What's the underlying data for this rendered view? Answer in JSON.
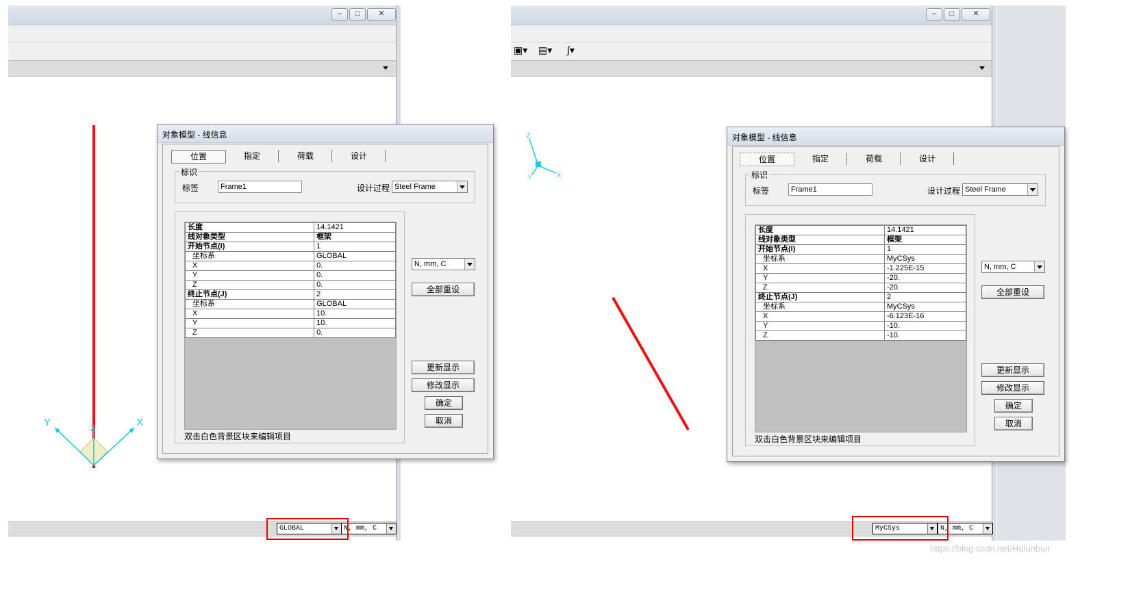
{
  "left": {
    "dialog": {
      "title": "对象模型 - 线信息",
      "tabs": [
        "位置",
        "指定",
        "荷载",
        "设计"
      ],
      "group_label": "标识",
      "label_caption": "标签",
      "label_value": "Frame1",
      "design_proc_caption": "设计过程",
      "design_proc_value": "Steel Frame",
      "rows": [
        {
          "k": "长度",
          "v": "14.1421",
          "bold": true
        },
        {
          "k": "线对象类型",
          "v": "框架",
          "bold": true
        },
        {
          "k": "开始节点(I)",
          "v": "1",
          "bold": true
        },
        {
          "k": "坐标系",
          "v": "GLOBAL"
        },
        {
          "k": "X",
          "v": "0."
        },
        {
          "k": "Y",
          "v": "0."
        },
        {
          "k": "Z",
          "v": "0."
        },
        {
          "k": "终止节点(J)",
          "v": "2",
          "bold": true
        },
        {
          "k": "坐标系",
          "v": "GLOBAL"
        },
        {
          "k": "X",
          "v": "10."
        },
        {
          "k": "Y",
          "v": "10."
        },
        {
          "k": "Z",
          "v": "0."
        }
      ],
      "hint": "双击白色背景区块来编辑项目",
      "units": "N, mm, C",
      "reset_all": "全部重设",
      "refresh": "更新显示",
      "modify": "修改显示",
      "ok": "确定",
      "cancel": "取消"
    },
    "axes": {
      "x": "X",
      "y": "Y",
      "z": "Z"
    },
    "status_csys": "GLOBAL",
    "status_units": "N, mm, C"
  },
  "right": {
    "dialog": {
      "title": "对象模型 - 线信息",
      "tabs": [
        "位置",
        "指定",
        "荷载",
        "设计"
      ],
      "group_label": "标识",
      "label_caption": "标签",
      "label_value": "Frame1",
      "design_proc_caption": "设计过程",
      "design_proc_value": "Steel Frame",
      "rows": [
        {
          "k": "长度",
          "v": "14.1421",
          "bold": true
        },
        {
          "k": "线对象类型",
          "v": "框架",
          "bold": true
        },
        {
          "k": "开始节点(I)",
          "v": "1",
          "bold": true
        },
        {
          "k": "坐标系",
          "v": "MyCSys"
        },
        {
          "k": "X",
          "v": "-1.225E-15"
        },
        {
          "k": "Y",
          "v": "-20."
        },
        {
          "k": "Z",
          "v": "-20."
        },
        {
          "k": "终止节点(J)",
          "v": "2",
          "bold": true
        },
        {
          "k": "坐标系",
          "v": "MyCSys"
        },
        {
          "k": "X",
          "v": "-6.123E-16"
        },
        {
          "k": "Y",
          "v": "-10."
        },
        {
          "k": "Z",
          "v": "-10."
        }
      ],
      "hint": "双击白色背景区块来编辑项目",
      "units": "N, mm, C",
      "reset_all": "全部重设",
      "refresh": "更新显示",
      "modify": "修改显示",
      "ok": "确定",
      "cancel": "取消"
    },
    "axes": {
      "x": "X",
      "y": "Y",
      "z": "Z"
    },
    "status_csys": "MyCSys",
    "status_units": "N, mm, C"
  },
  "colors": {
    "frame_line": "#ee1111",
    "axis": "#22c7e6",
    "highlight_box": "#e60000"
  },
  "watermark": "https://blog.csdn.net/Hulunbuir"
}
